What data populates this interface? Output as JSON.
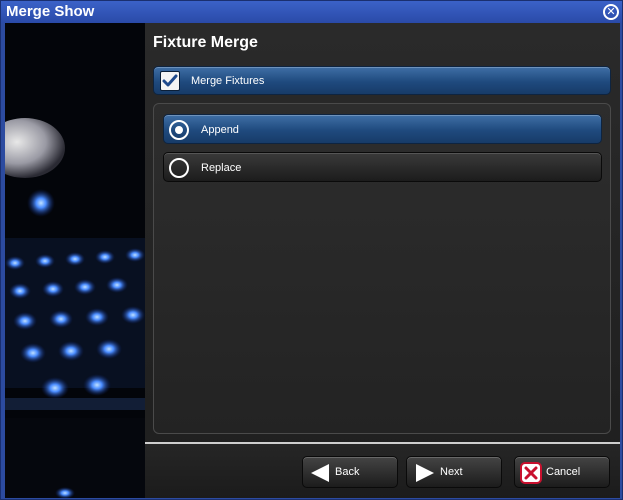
{
  "window": {
    "title": "Merge Show",
    "close_icon": "close-circle-icon"
  },
  "main": {
    "heading": "Fixture Merge",
    "merge_fixtures": {
      "label": "Merge Fixtures",
      "checked": true
    },
    "options": [
      {
        "label": "Append",
        "selected": true
      },
      {
        "label": "Replace",
        "selected": false
      }
    ]
  },
  "footer": {
    "back_label": "Back",
    "next_label": "Next",
    "cancel_label": "Cancel"
  },
  "colors": {
    "titlebar": "#2c4ba0",
    "selected": "#1f4a7e",
    "cancel_icon": "#c8102e"
  }
}
